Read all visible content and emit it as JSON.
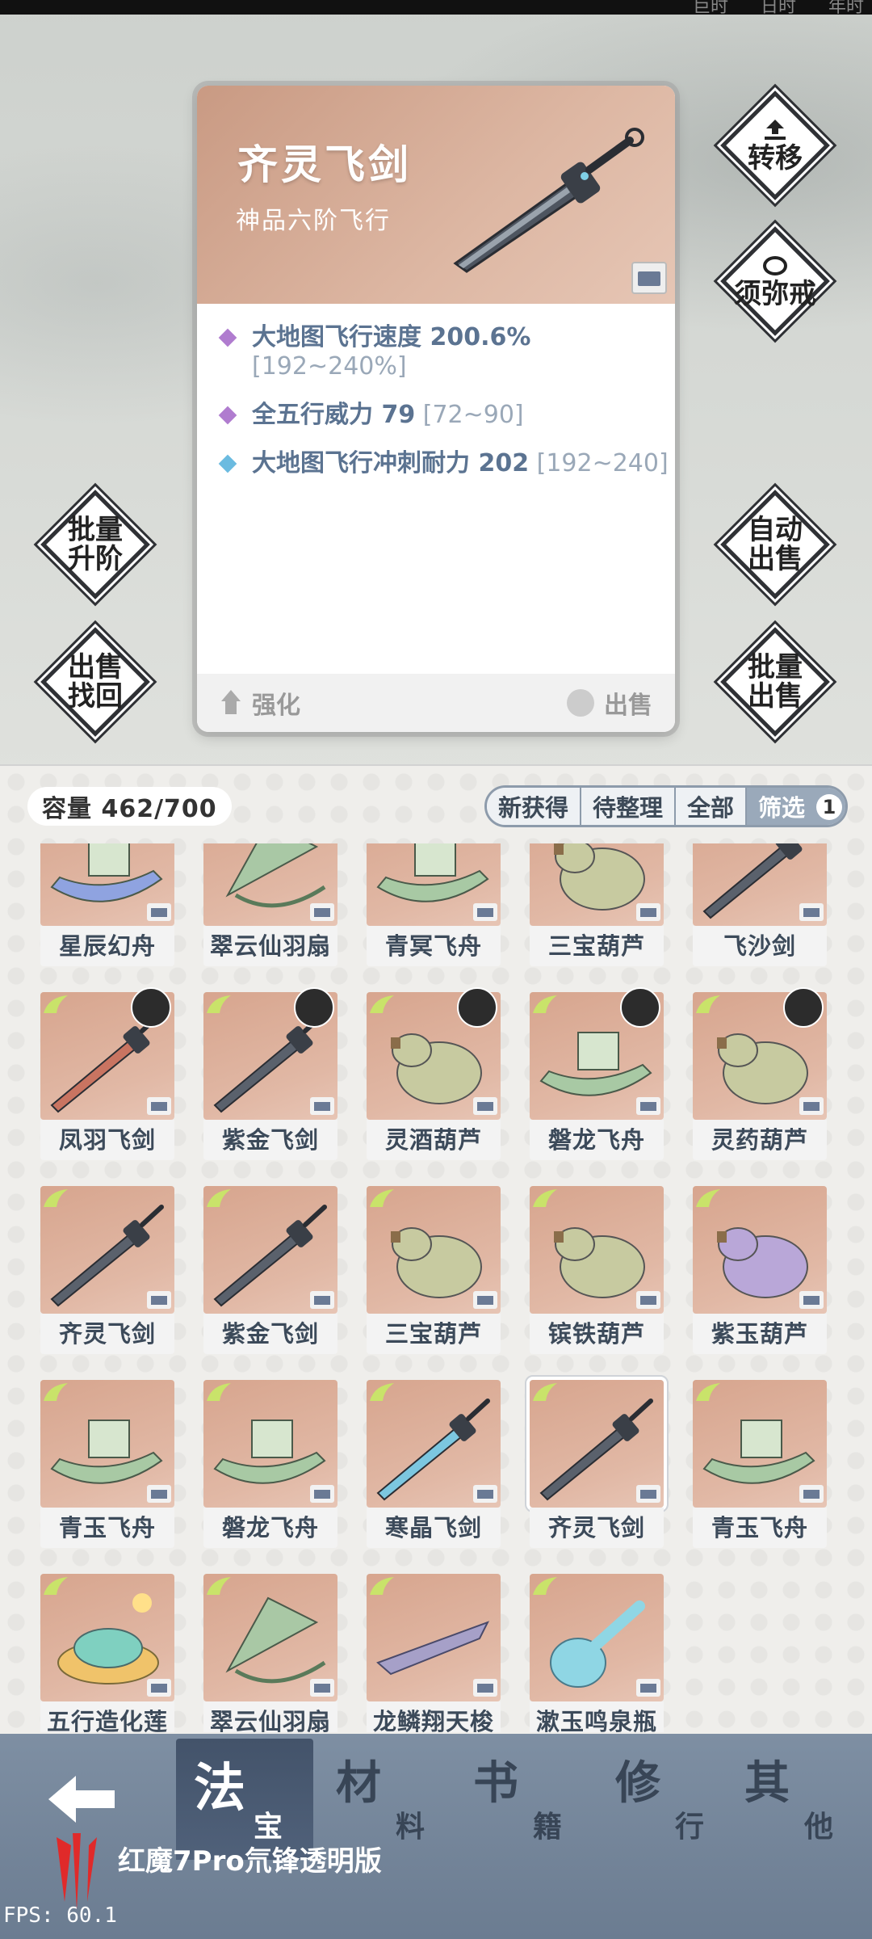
{
  "topbar": {
    "tabs": [
      "巨时",
      "日时",
      "年时"
    ]
  },
  "detail": {
    "title": "齐灵飞剑",
    "subtitle": "神品六阶飞行",
    "stats": [
      {
        "name": "大地图飞行速度 200.6%",
        "range": " [192~240%]",
        "color": "#b07ccf"
      },
      {
        "name": "全五行威力 79",
        "range": " [72~90]",
        "color": "#b07ccf"
      },
      {
        "name": "大地图飞行冲刺耐力 202",
        "range": " [192~240]",
        "color": "#6bbbe0"
      }
    ],
    "enhance_label": "强化",
    "sell_label": "出售"
  },
  "side_buttons": {
    "transfer": "转移",
    "sumeru": "须弥戒",
    "batch_upgrade": [
      "批量",
      "升阶"
    ],
    "auto_sell": [
      "自动",
      "出售"
    ],
    "sell_recover": [
      "出售",
      "找回"
    ],
    "batch_sell": [
      "批量",
      "出售"
    ]
  },
  "inventory": {
    "capacity": "容量 462/700",
    "filters": [
      "新获得",
      "待整理",
      "全部",
      "筛选"
    ],
    "filter_badge": "1",
    "items": [
      {
        "name": "星辰幻舟",
        "kind": "ship-blue"
      },
      {
        "name": "翠云仙羽扇",
        "kind": "fan"
      },
      {
        "name": "青冥飞舟",
        "kind": "ship"
      },
      {
        "name": "三宝葫芦",
        "kind": "gourd"
      },
      {
        "name": "飞沙剑",
        "kind": "sword"
      },
      {
        "name": "凤羽飞剑",
        "kind": "sword-red"
      },
      {
        "name": "紫金飞剑",
        "kind": "sword"
      },
      {
        "name": "灵酒葫芦",
        "kind": "gourd"
      },
      {
        "name": "磐龙飞舟",
        "kind": "ship"
      },
      {
        "name": "灵药葫芦",
        "kind": "gourd"
      },
      {
        "name": "齐灵飞剑",
        "kind": "sword"
      },
      {
        "name": "紫金飞剑",
        "kind": "sword"
      },
      {
        "name": "三宝葫芦",
        "kind": "gourd"
      },
      {
        "name": "镔铁葫芦",
        "kind": "gourd"
      },
      {
        "name": "紫玉葫芦",
        "kind": "gourd-purple"
      },
      {
        "name": "青玉飞舟",
        "kind": "ship"
      },
      {
        "name": "磐龙飞舟",
        "kind": "ship"
      },
      {
        "name": "寒晶飞剑",
        "kind": "sword-blue"
      },
      {
        "name": "齐灵飞剑",
        "kind": "sword"
      },
      {
        "name": "青玉飞舟",
        "kind": "ship"
      },
      {
        "name": "五行造化莲",
        "kind": "lotus"
      },
      {
        "name": "翠云仙羽扇",
        "kind": "fan"
      },
      {
        "name": "龙鳞翔天梭",
        "kind": "shuttle"
      },
      {
        "name": "漱玉鸣泉瓶",
        "kind": "bottle"
      }
    ]
  },
  "nav": {
    "tabs": [
      {
        "big": "法",
        "small": "宝"
      },
      {
        "big": "材",
        "small": "料"
      },
      {
        "big": "书",
        "small": "籍"
      },
      {
        "big": "修",
        "small": "行"
      },
      {
        "big": "其",
        "small": "他"
      }
    ],
    "device": "红魔7Pro氘锋透明版"
  },
  "fps": "FPS: 60.1"
}
